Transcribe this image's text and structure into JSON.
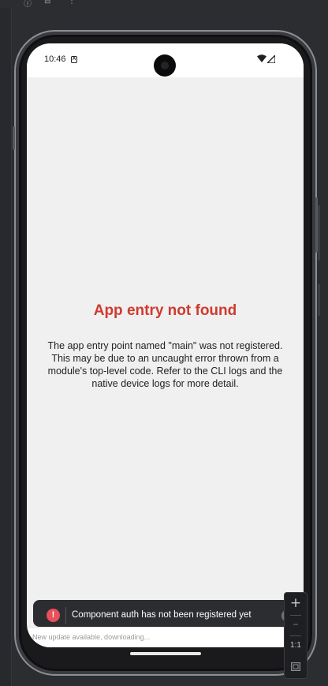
{
  "toolbar": {
    "icons": [
      "info-icon",
      "device-icon",
      "more-icon"
    ]
  },
  "status_bar": {
    "time": "10:46",
    "badge": "A",
    "icons": [
      "wifi-icon",
      "signal-icon"
    ]
  },
  "error": {
    "title": "App entry not found",
    "message": "The app entry point named \"main\" was not registered. This may be due to an uncaught error thrown from a module's top-level code. Refer to the CLI logs and the native device logs for more detail."
  },
  "toast": {
    "icon": "!",
    "text": "Component auth has not been registered yet",
    "close": "×"
  },
  "update_bar": {
    "text": "New update available, downloading..."
  },
  "zoom_controls": {
    "zoom_in": "+",
    "zoom_out": "–",
    "actual_size": "1:1",
    "fit_icon": "fit-screen-icon"
  },
  "colors": {
    "error_title": "#d03a2f",
    "toast_bg": "#2c2d30",
    "toast_icon": "#e8505b",
    "screen_bg": "#f0f0f0"
  }
}
